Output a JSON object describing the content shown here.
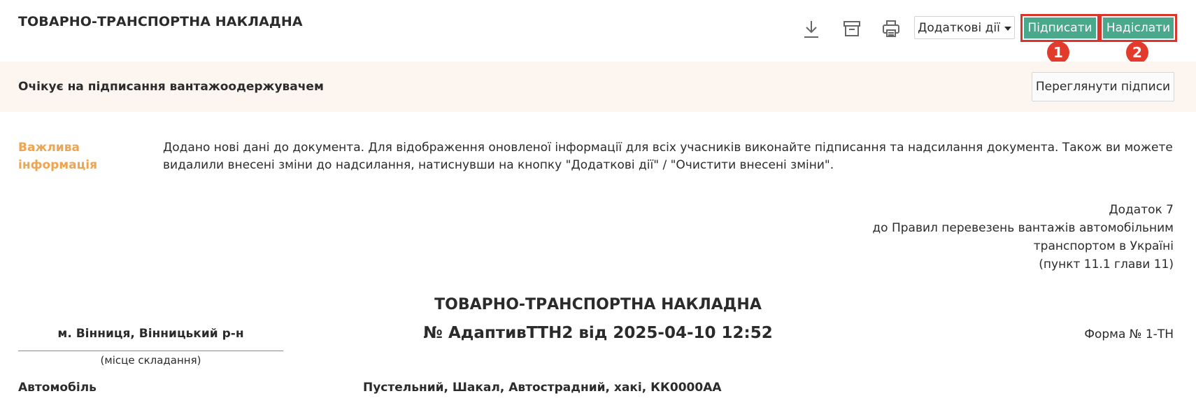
{
  "header": {
    "title": "ТОВАРНО-ТРАНСПОРТНА НАКЛАДНА",
    "icons": [
      "download-icon",
      "archive-icon",
      "print-icon"
    ],
    "more_actions_label": "Додаткові дії",
    "sign_label": "Підписати",
    "send_label": "Надіслати",
    "step_badges": [
      "1",
      "2"
    ]
  },
  "status": {
    "text": "Очікує на підписання вантажоодержувачем",
    "view_signatures_label": "Переглянути підписи"
  },
  "notice": {
    "label": "Важлива інформація",
    "text": "Додано нові дані до документа. Для відображення оновленої інформації для всіх учасників виконайте підписання та надсилання документа. Також ви можете видалили внесені зміни до надсилання, натиснувши на кнопку \"Додаткові дії\" / \"Очистити внесені зміни\"."
  },
  "document": {
    "appendix_lines": [
      "Додаток 7",
      "до Правил перевезень вантажів автомобільним",
      "транспортом в Україні",
      "(пункт 11.1 глави 11)"
    ],
    "title": "ТОВАРНО-ТРАНСПОРТНА НАКЛАДНА",
    "number_line": "№ АдаптивТТН2 від 2025-04-10 12:52",
    "place": "м. Вінниця, Вінницький р-н",
    "place_caption": "(місце складання)",
    "form_number": "Форма № 1-ТН",
    "vehicle_label": "Автомобіль",
    "vehicle_value": "Пустельний, Шакал, Автострадний, хакі, КК0000АА"
  },
  "colors": {
    "primary": "#4aa98a",
    "highlight": "#d9362b",
    "badge": "#e23b2b",
    "notice_label": "#eea552",
    "status_bg": "#fdf5ef"
  }
}
